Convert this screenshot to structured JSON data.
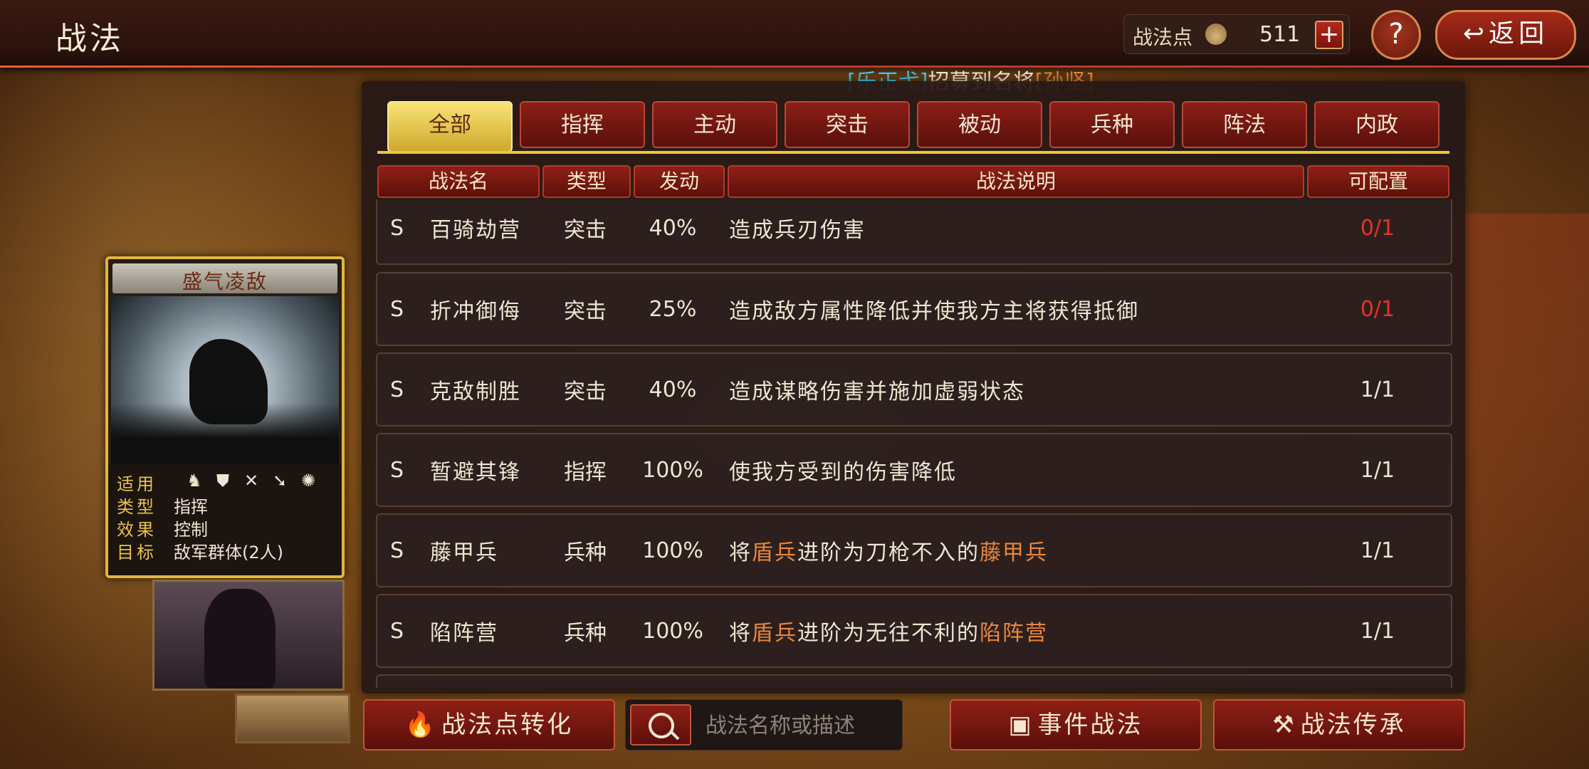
{
  "header": {
    "title": "战法",
    "points_label": "战法点",
    "points_value": "511",
    "plus_label": "+",
    "help_label": "?",
    "back_label": "返回",
    "back_icon": "back-arrow-icon"
  },
  "broadcast": {
    "open1": "[",
    "player": "乐正弋",
    "close1": "]",
    "text": "招募到名将",
    "open2": "[",
    "general": "孙坚",
    "close2": "]"
  },
  "tabs": [
    "全部",
    "指挥",
    "主动",
    "突击",
    "被动",
    "兵种",
    "阵法",
    "内政"
  ],
  "active_tab": 0,
  "columns": [
    "战法名",
    "类型",
    "发动",
    "战法说明",
    "可配置"
  ],
  "rows": [
    {
      "grade": "S",
      "name": "百骑劫营",
      "type": "突击",
      "rate": "40%",
      "desc": [
        "造成兵刃伤害"
      ],
      "cfg": "0/1"
    },
    {
      "grade": "S",
      "name": "折冲御侮",
      "type": "突击",
      "rate": "25%",
      "desc": [
        "造成敌方属性降低并使我方主将获得抵御"
      ],
      "cfg": "0/1"
    },
    {
      "grade": "S",
      "name": "克敌制胜",
      "type": "突击",
      "rate": "40%",
      "desc": [
        "造成谋略伤害并施加虚弱状态"
      ],
      "cfg": "1/1"
    },
    {
      "grade": "S",
      "name": "暂避其锋",
      "type": "指挥",
      "rate": "100%",
      "desc": [
        "使我方受到的伤害降低"
      ],
      "cfg": "1/1"
    },
    {
      "grade": "S",
      "name": "藤甲兵",
      "type": "兵种",
      "rate": "100%",
      "desc": [
        "将",
        "盾兵",
        "进阶为刀枪不入的",
        "藤甲兵"
      ],
      "cfg": "1/1"
    },
    {
      "grade": "S",
      "name": "陷阵营",
      "type": "兵种",
      "rate": "100%",
      "desc": [
        "将",
        "盾兵",
        "进阶为无往不利的",
        "陷阵营"
      ],
      "cfg": "1/1"
    }
  ],
  "colors": {
    "accent_red": "#8f1f14",
    "gold": "#e2b73a",
    "highlight_orange": "#e8883b",
    "full_red": "#e0342a",
    "cyan": "#3fd2f2"
  },
  "skill_card": {
    "title": "盛气凌敌",
    "apply_label": "适用",
    "apply_icons": [
      "cavalry-icon",
      "shield-icon",
      "archer-icon",
      "spear-icon",
      "siege-icon"
    ],
    "type_label": "类型",
    "type_value": "指挥",
    "effect_label": "效果",
    "effect_value": "控制",
    "target_label": "目标",
    "target_value": "敌军群体(2人)"
  },
  "bottom": {
    "convert_label": "战法点转化",
    "search_placeholder": "战法名称或描述",
    "event_label": "事件战法",
    "inherit_label": "战法传承"
  }
}
